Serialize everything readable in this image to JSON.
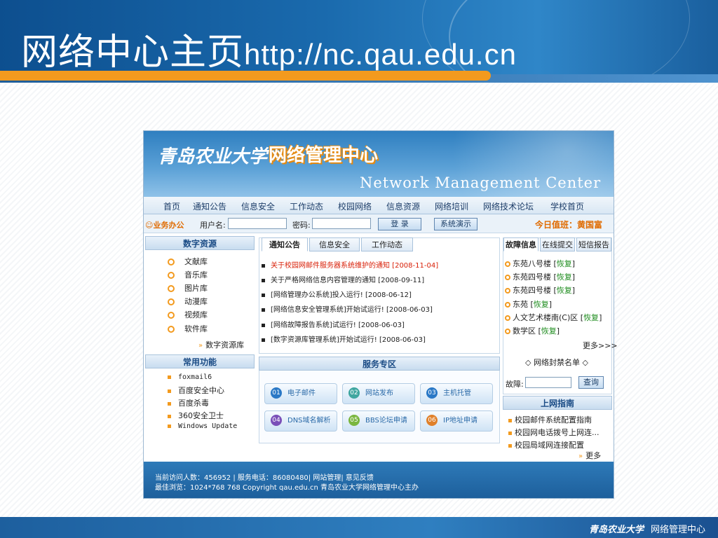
{
  "slide": {
    "title_cn": "网络中心主页",
    "title_url": "http://nc.qau.edu.cn",
    "footer_logo": "青岛农业大学",
    "footer_text": "网络管理中心"
  },
  "site": {
    "banner_logo": "青岛农业大学",
    "banner_title": "网络管理中心",
    "banner_en": "Network Management Center",
    "nav": [
      "首页",
      "通知公告",
      "信息安全",
      "工作动态",
      "校园网络",
      "信息资源",
      "网络培训",
      "网络技术论坛",
      "学校首页"
    ],
    "login": {
      "section": "业务办公",
      "user_label": "用户名:",
      "pass_label": "密码:",
      "login_btn": "登 录",
      "demo_btn": "系统演示",
      "duty": "今日值班：黄国富"
    },
    "digital": {
      "title": "数字资源",
      "items": [
        "文献库",
        "音乐库",
        "图片库",
        "动漫库",
        "视频库",
        "软件库"
      ],
      "more": "数字资源库"
    },
    "common": {
      "title": "常用功能",
      "items": [
        "foxmail6",
        "百度安全中心",
        "百度杀毒",
        "360安全卫士",
        "Windows Update"
      ]
    },
    "notice": {
      "tabs": [
        "通知公告",
        "信息安全",
        "工作动态"
      ],
      "items": [
        "关于校园网邮件服务器系统维护的通知 [2008-11-04]",
        "关于严格网络信息内容管理的通知 [2008-09-11]",
        "[网络管理办公系统]投入运行! [2008-06-12]",
        "[网络信息安全管理系统]开始试运行! [2008-06-03]",
        "[网络故障报告系统]试运行! [2008-06-03]",
        "[数字资源库管理系统]开始试运行! [2008-06-03]"
      ]
    },
    "service": {
      "title": "服务专区",
      "items": [
        {
          "num": "01",
          "label": "电子邮件"
        },
        {
          "num": "02",
          "label": "网站发布"
        },
        {
          "num": "03",
          "label": "主机托管"
        },
        {
          "num": "04",
          "label": "DNS域名解析"
        },
        {
          "num": "05",
          "label": "BBS论坛申请"
        },
        {
          "num": "06",
          "label": "IP地址申请"
        }
      ]
    },
    "fault": {
      "tabs": [
        "故障信息",
        "在线提交",
        "短信报告"
      ],
      "items": [
        {
          "place": "东苑八号楼",
          "status": "恢复"
        },
        {
          "place": "东苑四号楼",
          "status": "恢复"
        },
        {
          "place": "东苑四号楼",
          "status": "恢复"
        },
        {
          "place": "东苑",
          "status": "恢复"
        },
        {
          "place": "人文艺术楼南(C)区",
          "status": "恢复"
        },
        {
          "place": "数学区",
          "status": "恢复"
        }
      ],
      "more": "更多>>>",
      "blocklist": "◇ 网络封禁名单 ◇",
      "fault_label": "故障:",
      "query_btn": "查询"
    },
    "guide": {
      "title": "上网指南",
      "items": [
        "校园邮件系统配置指南",
        "校园网电话拨号上网连...",
        "校园局域网连接配置"
      ],
      "more": "更多"
    },
    "footer": {
      "line1": "当前访问人数：456952 | 服务电话：86080480| 网站管理| 意见反馈",
      "line2": "最佳浏览：1024*768 768 Copyright qau.edu.cn 青岛农业大学网络管理中心主办"
    }
  }
}
